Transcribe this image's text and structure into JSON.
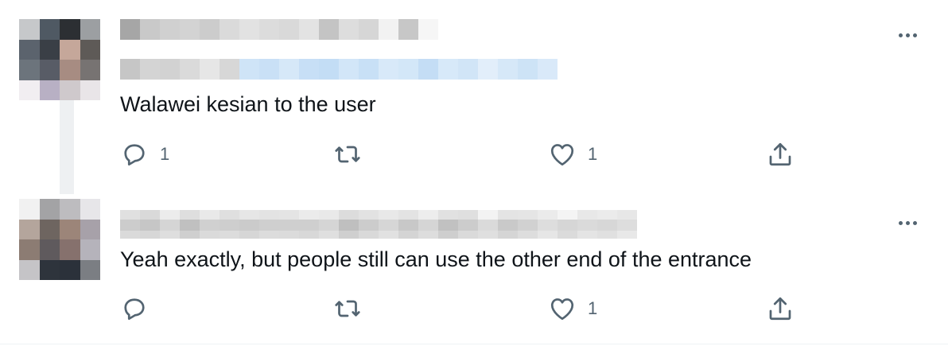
{
  "tweets": [
    {
      "text": "Walawei kesian to the user",
      "reply_count": "1",
      "retweet_count": "",
      "like_count": "1",
      "more_icon": "more-horizontal-icon"
    },
    {
      "text": "Yeah exactly, but people still can use the other end of the entrance",
      "reply_count": "",
      "retweet_count": "",
      "like_count": "1",
      "more_icon": "more-horizontal-icon"
    }
  ],
  "colors": {
    "text_primary": "#0f1419",
    "icon_gray": "#536471",
    "link_blue_blurred": "#cfe4f7",
    "divider": "#eff3f4"
  },
  "icons": {
    "reply": "reply-icon",
    "retweet": "retweet-icon",
    "like": "heart-icon",
    "share": "share-icon"
  }
}
